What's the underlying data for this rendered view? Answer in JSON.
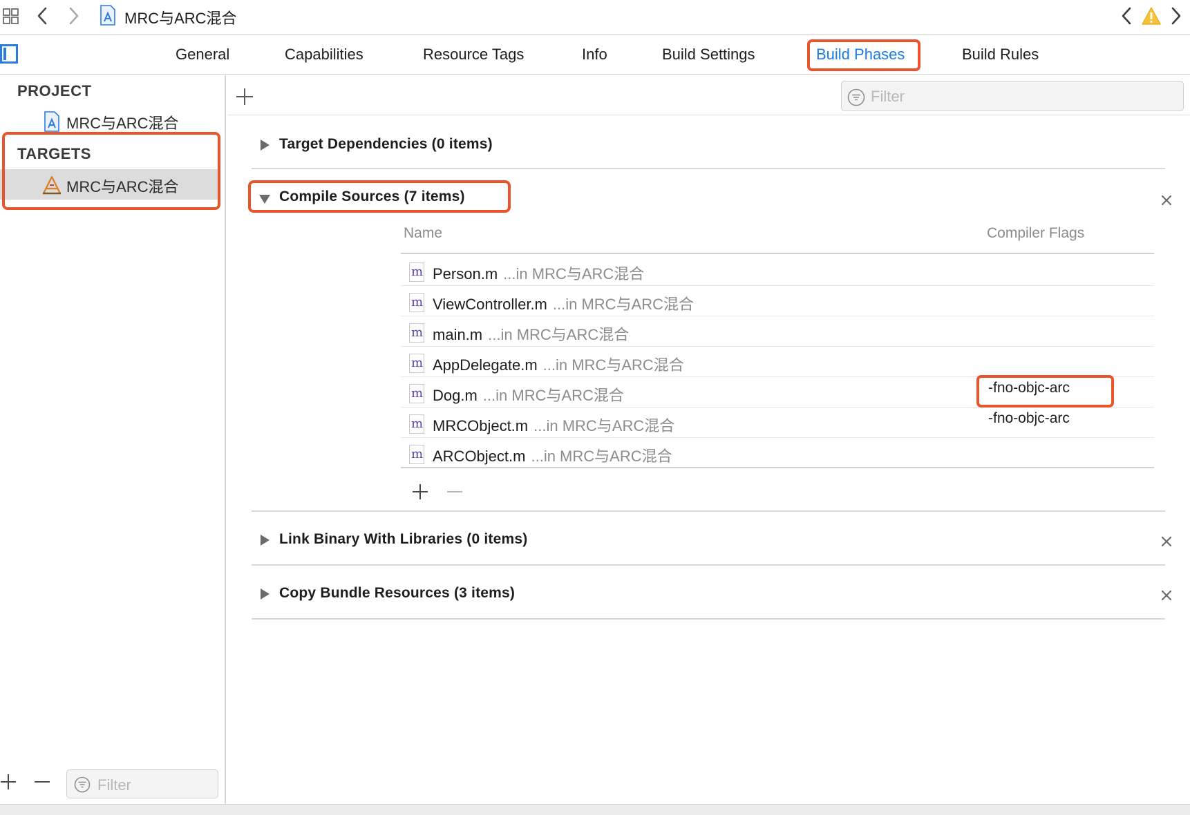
{
  "jump_bar": {
    "breadcrumb": "MRC与ARC混合",
    "grid_icon": "related-items-grid-icon",
    "back_icon": "chevron-left-icon",
    "forward_icon": "chevron-right-icon",
    "warning_icon": "warning-triangle-icon",
    "warning_color": "#f5c33b"
  },
  "tabs": [
    {
      "label": "General"
    },
    {
      "label": "Capabilities"
    },
    {
      "label": "Resource Tags"
    },
    {
      "label": "Info"
    },
    {
      "label": "Build Settings"
    },
    {
      "label": "Build Phases",
      "active": true
    },
    {
      "label": "Build Rules"
    }
  ],
  "navigator": {
    "project_header": "PROJECT",
    "project_item": "MRC与ARC混合",
    "targets_header": "TARGETS",
    "target_item": "MRC与ARC混合",
    "filter_placeholder": "Filter"
  },
  "content": {
    "filter_placeholder": "Filter",
    "phases": [
      {
        "title": "Target Dependencies (0 items)",
        "expanded": false
      },
      {
        "title": "Compile Sources (7 items)",
        "expanded": true
      },
      {
        "title": "Link Binary With Libraries (0 items)",
        "expanded": false
      },
      {
        "title": "Copy Bundle Resources (3 items)",
        "expanded": false
      }
    ],
    "compile_sources": {
      "col_name": "Name",
      "col_flags": "Compiler Flags",
      "rows": [
        {
          "file": "Person.m",
          "location": "...in MRC与ARC混合",
          "flags": ""
        },
        {
          "file": "ViewController.m",
          "location": "...in MRC与ARC混合",
          "flags": ""
        },
        {
          "file": "main.m",
          "location": "...in MRC与ARC混合",
          "flags": ""
        },
        {
          "file": "AppDelegate.m",
          "location": "...in MRC与ARC混合",
          "flags": ""
        },
        {
          "file": "Dog.m",
          "location": "...in MRC与ARC混合",
          "flags": "-fno-objc-arc"
        },
        {
          "file": "MRCObject.m",
          "location": "...in MRC与ARC混合",
          "flags": "-fno-objc-arc"
        },
        {
          "file": "ARCObject.m",
          "location": "...in MRC与ARC混合",
          "flags": ""
        }
      ],
      "file_icon_letter": "m"
    }
  },
  "colors": {
    "accent": "#1b7ce0",
    "highlight_annotation": "#e8552b",
    "file_icon_letter": "#5a3e9e"
  }
}
